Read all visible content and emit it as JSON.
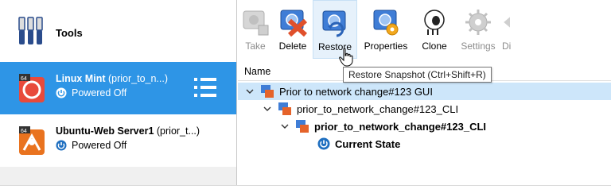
{
  "colors": {
    "selected_bg": "#2e95e6",
    "highlight_row": "#cde6fa",
    "toolbar_hover": "#e6f1fb",
    "disabled_text": "#8d8d8d"
  },
  "sidebar": {
    "tools_label": "Tools",
    "tools_icon": "tools-icon",
    "vms": [
      {
        "name": "Linux Mint",
        "snapshot": "(prior_to_n...)",
        "status": "Powered Off",
        "badge": "64",
        "selected": true
      },
      {
        "name": "Ubuntu-Web Server1",
        "snapshot": "(prior_t...)",
        "status": "Powered Off",
        "badge": "64",
        "selected": false
      }
    ]
  },
  "toolbar": {
    "buttons": [
      {
        "label": "Take",
        "icon": "take-snapshot-icon",
        "enabled": false
      },
      {
        "label": "Delete",
        "icon": "delete-snapshot-icon",
        "enabled": true
      },
      {
        "label": "Restore",
        "icon": "restore-snapshot-icon",
        "enabled": true
      },
      {
        "label": "Properties",
        "icon": "properties-icon",
        "enabled": true
      },
      {
        "label": "Clone",
        "icon": "clone-sheep-icon",
        "enabled": true
      },
      {
        "label": "Settings",
        "icon": "settings-gear-icon",
        "enabled": false
      },
      {
        "label": "Di",
        "icon": "discard-icon",
        "enabled": false
      }
    ]
  },
  "tooltip": "Restore Snapshot (Ctrl+Shift+R)",
  "snapshots": {
    "column_header": "Name",
    "rows": [
      {
        "label": "Prior to network change#123 GUI",
        "level": 0,
        "highlighted": true,
        "bold": false
      },
      {
        "label": "prior_to_network_change#123_CLI",
        "level": 1,
        "highlighted": false,
        "bold": false
      },
      {
        "label": "prior_to_network_change#123_CLI",
        "level": 2,
        "highlighted": false,
        "bold": true
      }
    ],
    "current_state": "Current State"
  }
}
